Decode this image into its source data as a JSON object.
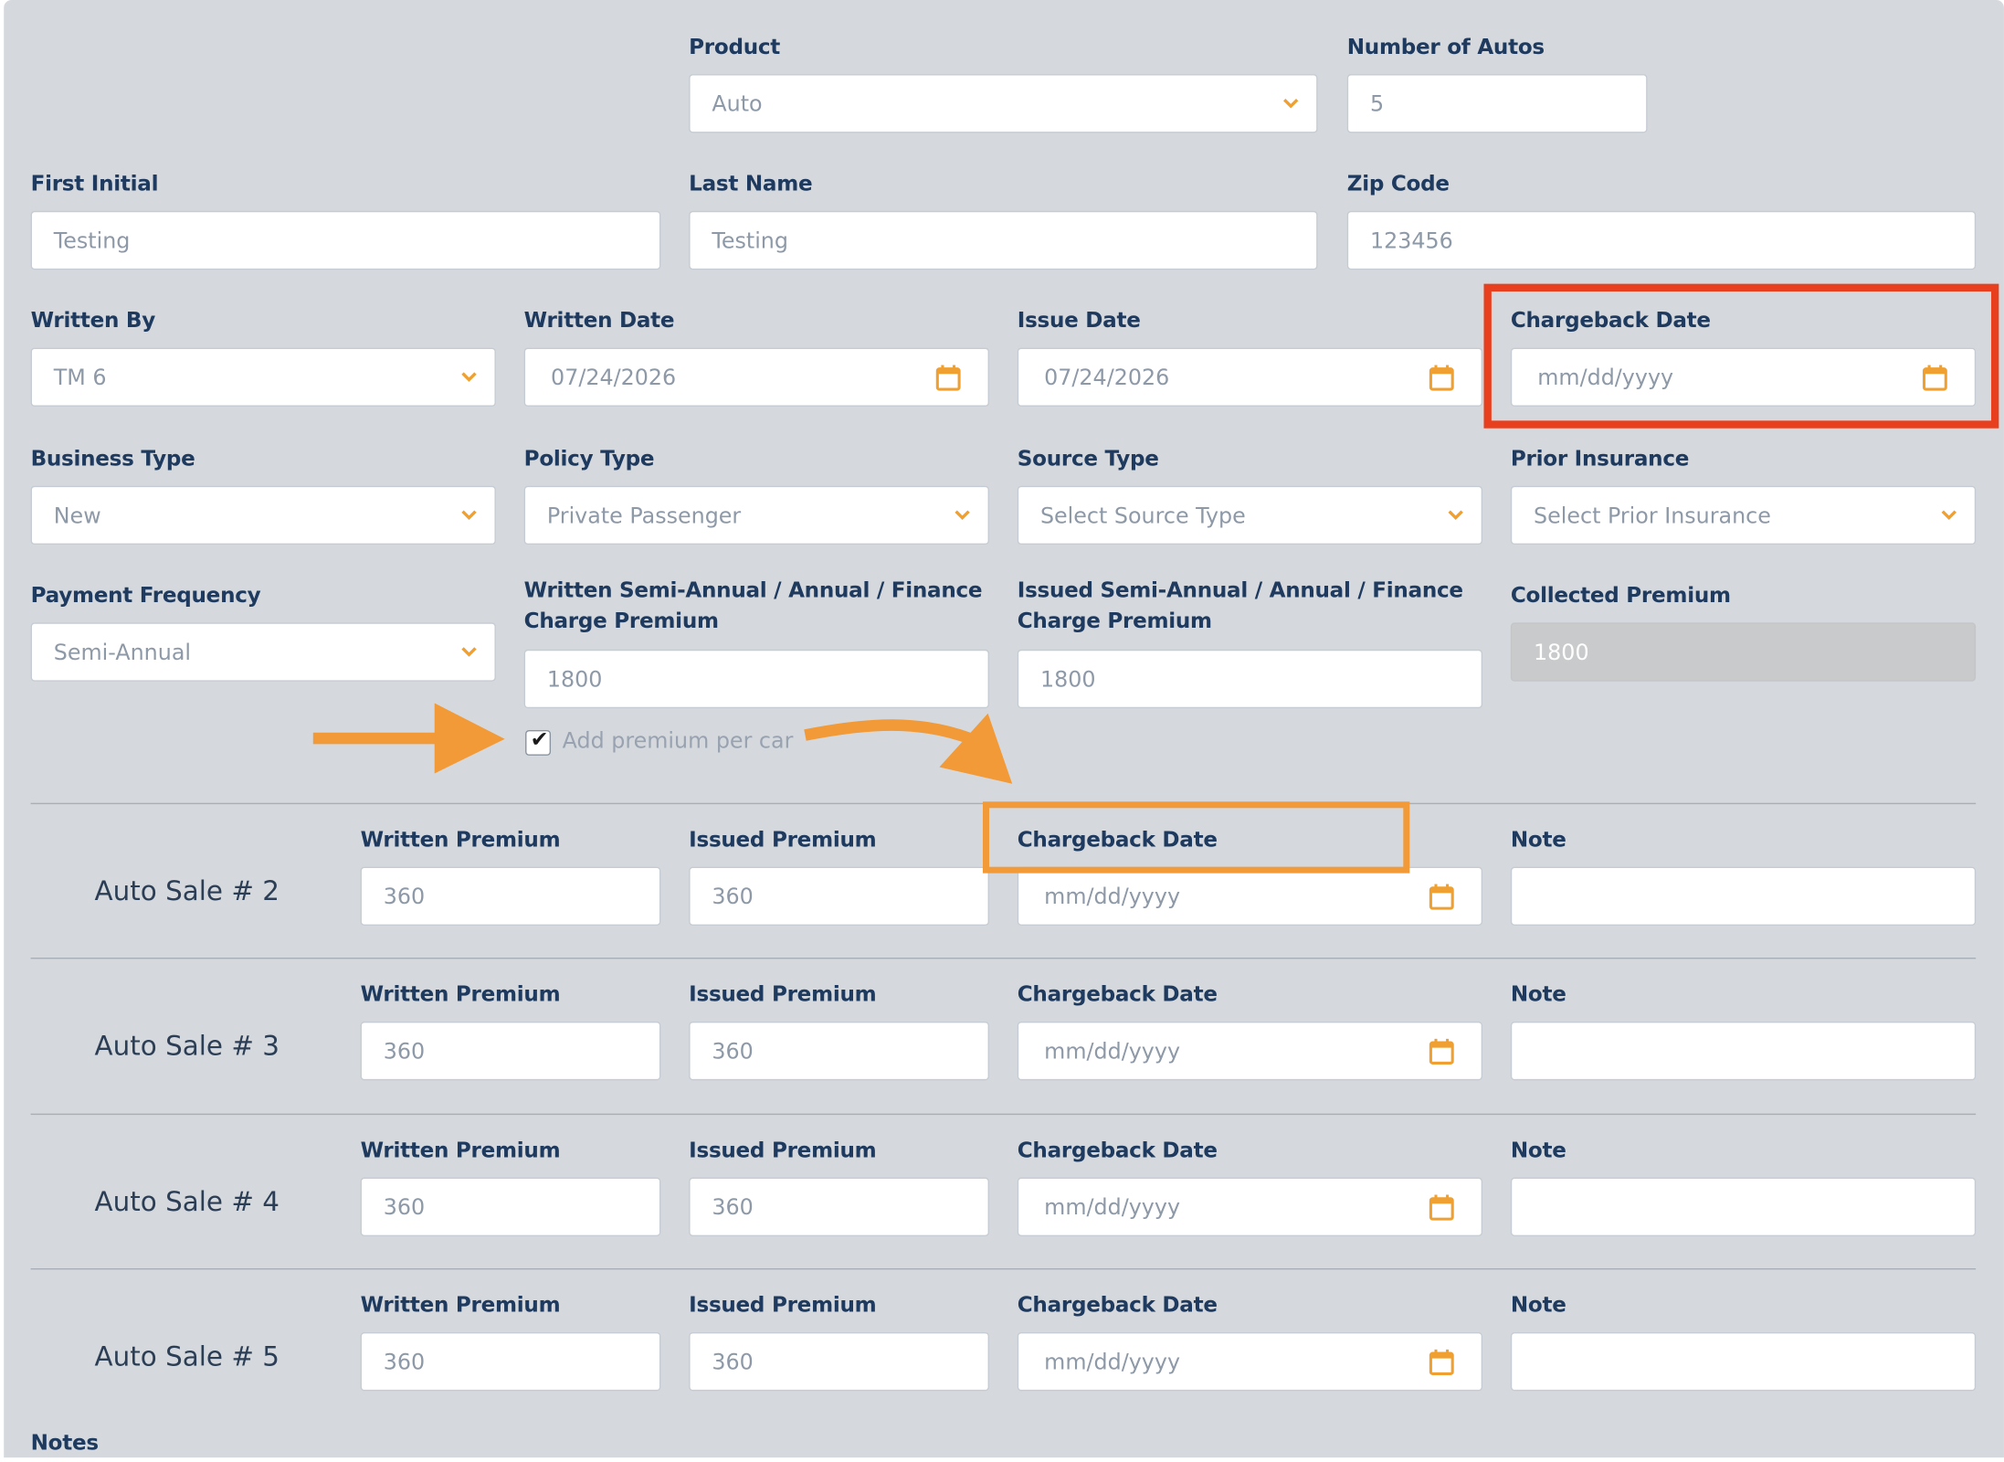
{
  "form": {
    "product": {
      "label": "Product",
      "value": "Auto"
    },
    "number_of_autos": {
      "label": "Number of Autos",
      "value": "5"
    },
    "first_initial": {
      "label": "First Initial",
      "value": "Testing"
    },
    "last_name": {
      "label": "Last Name",
      "value": "Testing"
    },
    "zip_code": {
      "label": "Zip Code",
      "value": "123456"
    },
    "written_by": {
      "label": "Written By",
      "value": "TM 6"
    },
    "written_date": {
      "label": "Written Date",
      "value": "07/24/2026"
    },
    "issue_date": {
      "label": "Issue Date",
      "value": "07/24/2026"
    },
    "chargeback_date": {
      "label": "Chargeback Date",
      "placeholder": "mm/dd/yyyy"
    },
    "business_type": {
      "label": "Business Type",
      "value": "New"
    },
    "policy_type": {
      "label": "Policy Type",
      "value": "Private Passenger"
    },
    "source_type": {
      "label": "Source Type",
      "placeholder": "Select Source Type"
    },
    "prior_insurance": {
      "label": "Prior Insurance",
      "placeholder": "Select Prior Insurance"
    },
    "payment_frequency": {
      "label": "Payment Frequency",
      "value": "Semi-Annual"
    },
    "written_premium": {
      "label": "Written Semi-Annual / Annual / Finance Charge Premium",
      "value": "1800"
    },
    "issued_premium": {
      "label": "Issued Semi-Annual / Annual / Finance Charge Premium",
      "value": "1800"
    },
    "collected_premium": {
      "label": "Collected Premium",
      "value": "1800"
    },
    "add_premium_per_car": {
      "label": "Add premium per car",
      "checked": true,
      "check_glyph": "✔"
    }
  },
  "auto_sales": [
    {
      "title": "Auto Sale # 2",
      "written_label": "Written Premium",
      "written": "360",
      "issued_label": "Issued Premium",
      "issued": "360",
      "chargeback_label": "Chargeback Date",
      "chargeback_placeholder": "mm/dd/yyyy",
      "note_label": "Note",
      "note": ""
    },
    {
      "title": "Auto Sale # 3",
      "written_label": "Written Premium",
      "written": "360",
      "issued_label": "Issued Premium",
      "issued": "360",
      "chargeback_label": "Chargeback Date",
      "chargeback_placeholder": "mm/dd/yyyy",
      "note_label": "Note",
      "note": ""
    },
    {
      "title": "Auto Sale # 4",
      "written_label": "Written Premium",
      "written": "360",
      "issued_label": "Issued Premium",
      "issued": "360",
      "chargeback_label": "Chargeback Date",
      "chargeback_placeholder": "mm/dd/yyyy",
      "note_label": "Note",
      "note": ""
    },
    {
      "title": "Auto Sale # 5",
      "written_label": "Written Premium",
      "written": "360",
      "issued_label": "Issued Premium",
      "issued": "360",
      "chargeback_label": "Chargeback Date",
      "chargeback_placeholder": "mm/dd/yyyy",
      "note_label": "Note",
      "note": ""
    }
  ],
  "notes": {
    "label": "Notes"
  },
  "icons": {
    "dropdown": "chevron-down-icon",
    "date": "calendar-icon",
    "checkbox": "checkmark-icon"
  },
  "colors": {
    "panel_bg": "#d5d9dd",
    "label_text": "#1e3a5f",
    "accent_icon": "#f0a030",
    "highlight_red": "#e8401f",
    "highlight_orange": "#f19a37",
    "disabled_bg": "#c9cacb"
  }
}
